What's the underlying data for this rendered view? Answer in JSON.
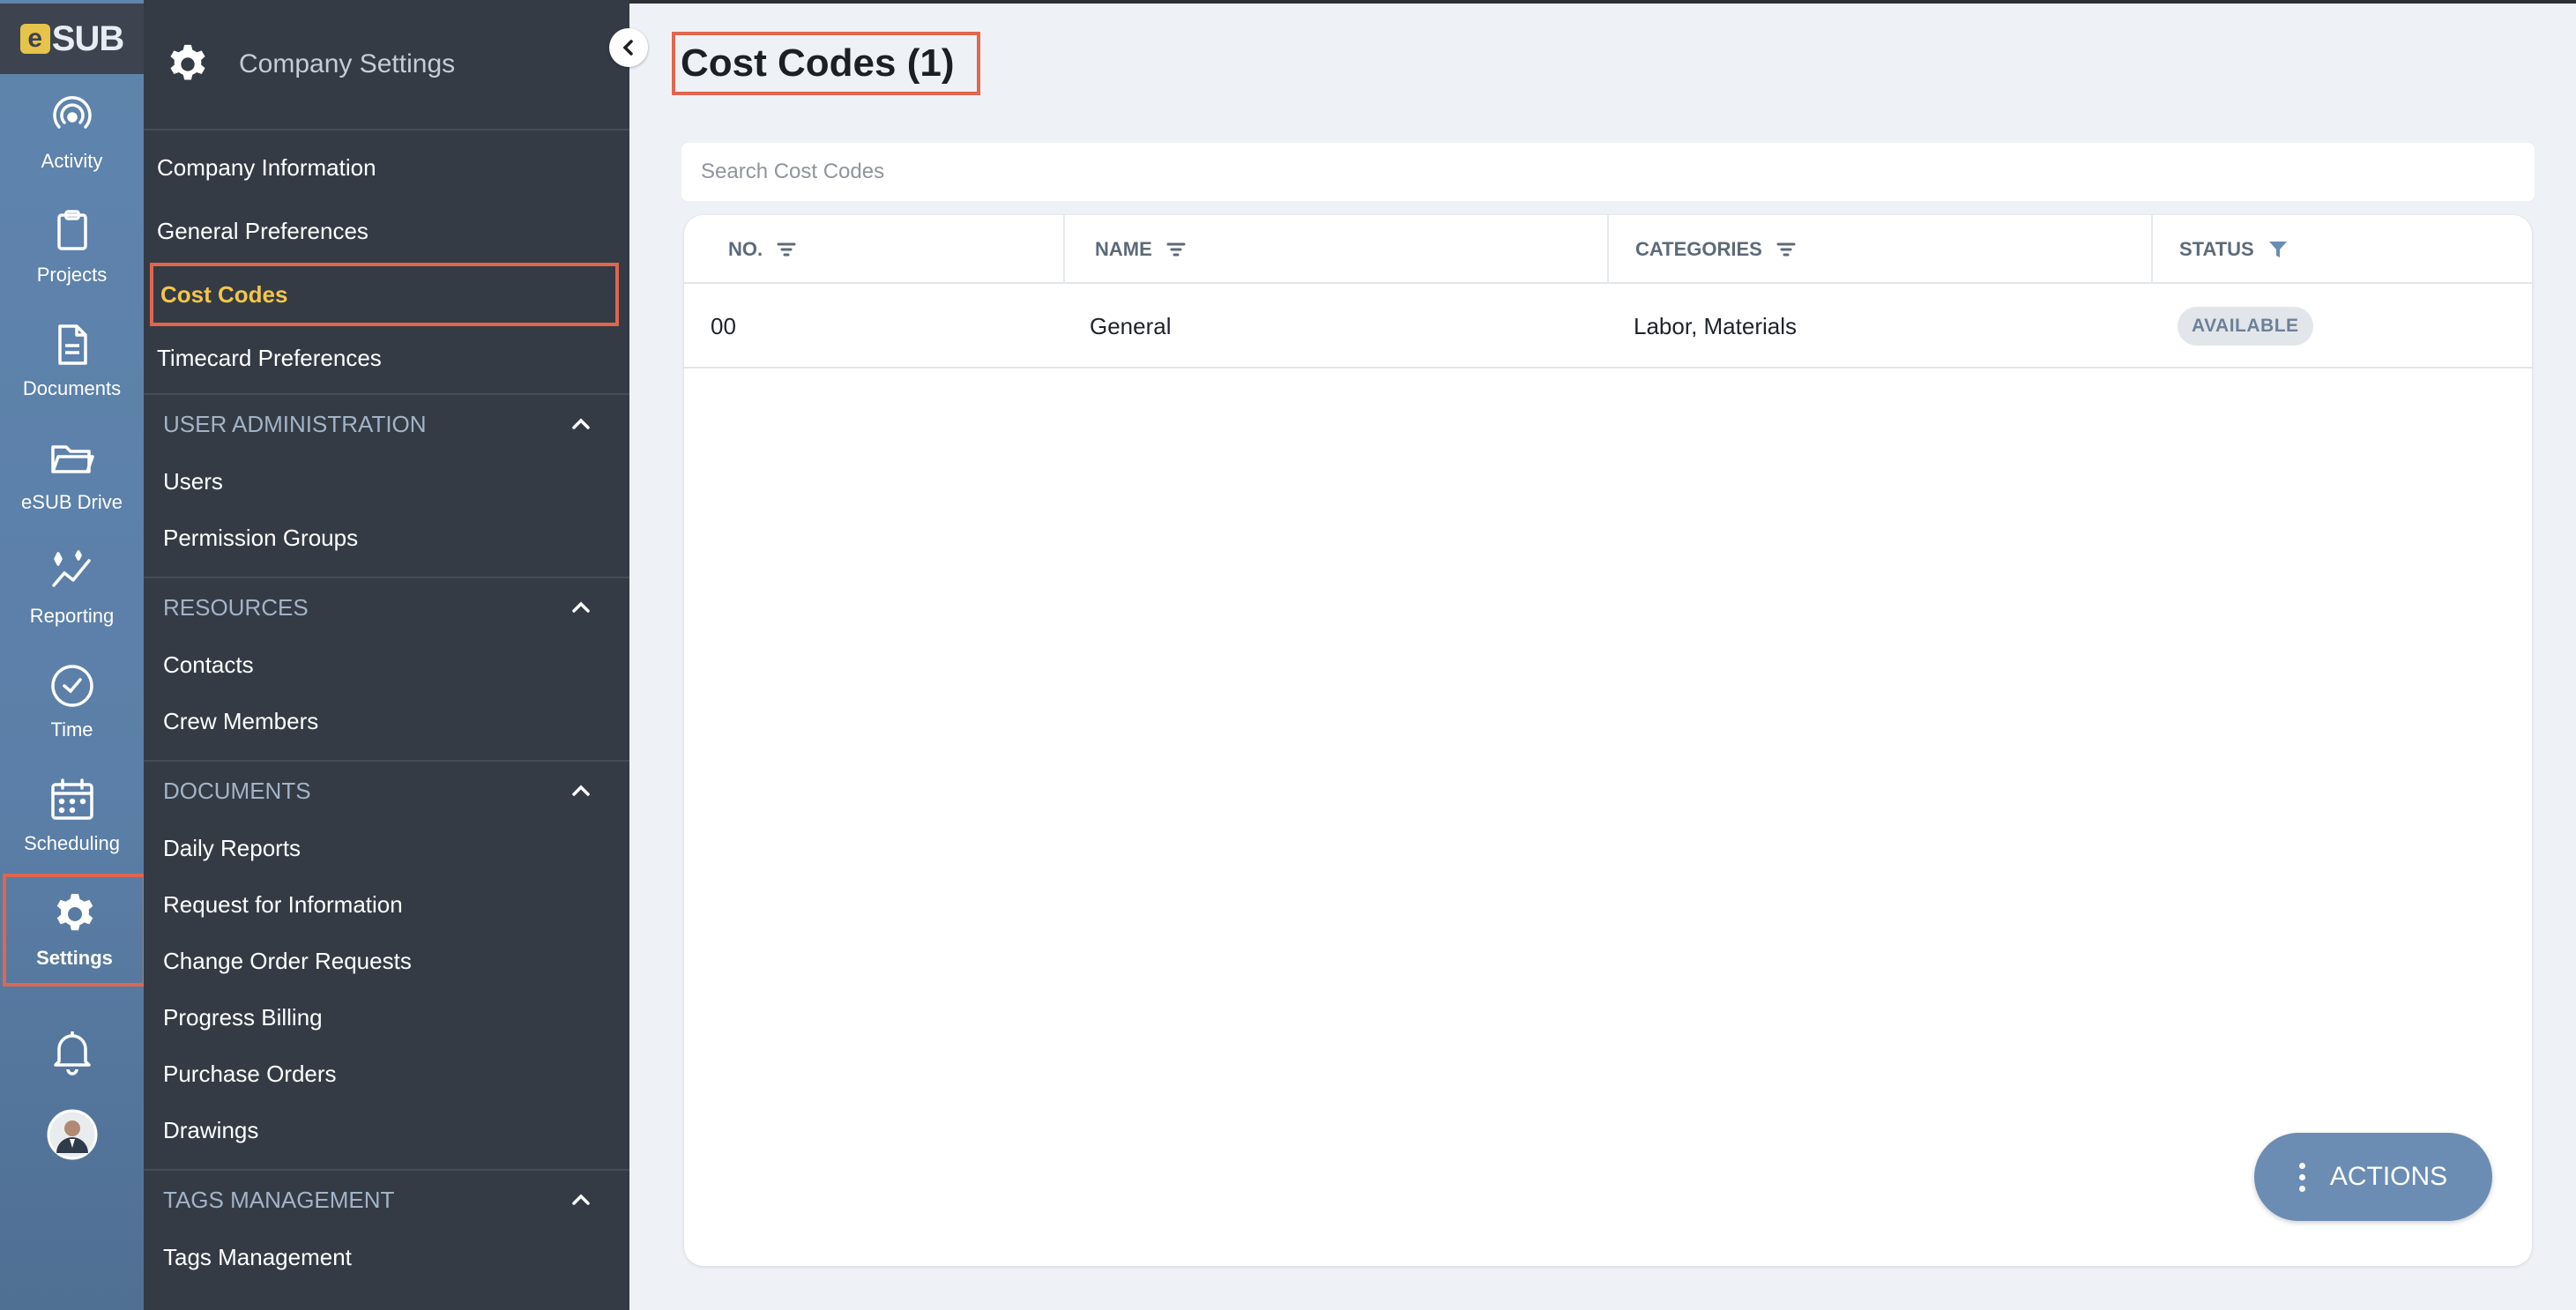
{
  "app": {
    "logo_letter": "e",
    "logo_text": "SUB"
  },
  "rail": {
    "items": [
      {
        "label": "Activity",
        "icon": "activity-icon"
      },
      {
        "label": "Projects",
        "icon": "clipboard-icon"
      },
      {
        "label": "Documents",
        "icon": "document-icon"
      },
      {
        "label": "eSUB Drive",
        "icon": "folder-icon"
      },
      {
        "label": "Reporting",
        "icon": "reporting-icon"
      },
      {
        "label": "Time",
        "icon": "clock-icon"
      },
      {
        "label": "Scheduling",
        "icon": "calendar-icon"
      },
      {
        "label": "Settings",
        "icon": "gear-icon",
        "active": true
      }
    ]
  },
  "panel": {
    "title": "Company Settings",
    "links": [
      "Company Information",
      "General Preferences",
      "Cost Codes",
      "Timecard Preferences"
    ],
    "selected": "Cost Codes",
    "sections": [
      {
        "title": "USER ADMINISTRATION",
        "items": [
          "Users",
          "Permission Groups"
        ]
      },
      {
        "title": "RESOURCES",
        "items": [
          "Contacts",
          "Crew Members"
        ]
      },
      {
        "title": "DOCUMENTS",
        "items": [
          "Daily Reports",
          "Request for Information",
          "Change Order Requests",
          "Progress Billing",
          "Purchase Orders",
          "Drawings"
        ]
      },
      {
        "title": "TAGS MANAGEMENT",
        "items": [
          "Tags Management"
        ]
      }
    ]
  },
  "main": {
    "title": "Cost Codes (1)",
    "search_placeholder": "Search Cost Codes",
    "columns": [
      "NO.",
      "NAME",
      "CATEGORIES",
      "STATUS"
    ],
    "rows": [
      {
        "no": "00",
        "name": "General",
        "categories": "Labor, Materials",
        "status": "AVAILABLE"
      }
    ],
    "actions_label": "ACTIONS"
  },
  "colors": {
    "accent_highlight": "#e0664e",
    "selected_text": "#f3c64a",
    "rail_bg": "#5f84ad",
    "panel_bg": "#343b45",
    "actions_bg": "#6b8db3"
  }
}
